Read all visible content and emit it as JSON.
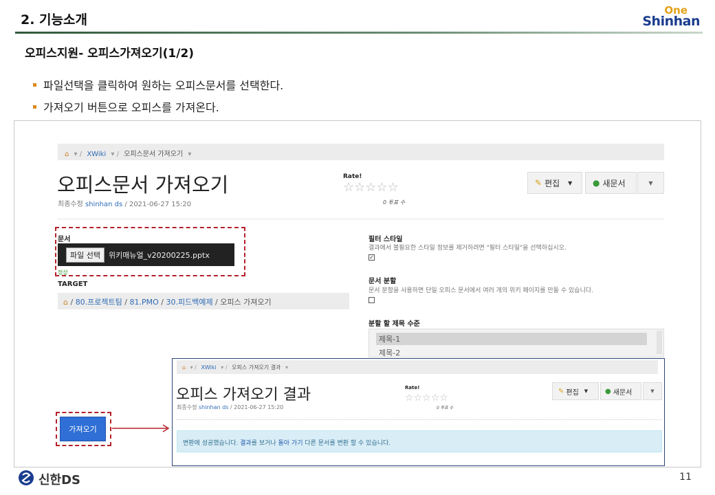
{
  "slide": {
    "title": "2. 기능소개",
    "logo_one": "One",
    "logo_shinhan": "Shinhan",
    "section_title": "오피스지원- 오피스가져오기(1/2)",
    "bullets": [
      "파일선택을 클릭하여 원하는 오피스문서를 선택한다.",
      "가져오기 버튼으로 오피스를 가져온다."
    ],
    "footer_logo": "신한DS",
    "page_number": "11"
  },
  "colors": {
    "accent_orange": "#d98b1a",
    "dashed_red": "#b3202a",
    "link_blue": "#2f6bb5",
    "primary_button": "#2f6fd6",
    "success_bg": "#d9edf7"
  },
  "wiki": {
    "breadcrumb": {
      "home_icon": "home-icon",
      "root": "XWiki",
      "page": "오피스문서 가져오기"
    },
    "page_title": "오피스문서 가져오기",
    "meta_prefix": "최종수정",
    "meta_user": "shinhan ds",
    "meta_date": "/ 2021-06-27 15:20",
    "rating_label": "Rate!",
    "rating_count": "0 투표 수",
    "edit_button": "편집",
    "new_doc_button": "새문서",
    "document_label": "문서",
    "file_select_button": "파일 선택",
    "file_name": "위키매뉴얼_v20200225.pptx",
    "status_text": "정상",
    "target_label": "TARGET",
    "target_path": [
      "80.프로젝트팀",
      "81.PMO",
      "30.피드백예제",
      "오피스 가져오기"
    ],
    "filter_style_label": "필터 스타일",
    "filter_style_hint": "결과에서 불필요한 스타일 정보를 제거하려면 \"필터 스타일\"을 선택하십시오.",
    "filter_style_checked": true,
    "split_doc_label": "문서 분할",
    "split_doc_hint": "문서 분할을 사용하면 단일 오피스 문서에서 여러 개의 위키 페이지를 만들 수 있습니다.",
    "split_doc_checked": false,
    "heading_level_label": "분할 할 제목 수준",
    "heading_options": [
      "제목-1",
      "제목-2"
    ],
    "import_button": "가져오기"
  },
  "result": {
    "breadcrumb": {
      "root": "XWiki",
      "page": "오피스 가져오기 결과"
    },
    "page_title": "오피스 가져오기 결과",
    "meta_prefix": "최종수정",
    "meta_user": "shinhan ds",
    "meta_date": "/ 2021-06-27 15:20",
    "rating_label": "Rate!",
    "rating_count": "0 투표 수",
    "edit_button": "편집",
    "new_doc_button": "새문서",
    "message_prefix": "변환에 성공했습니다. ",
    "message_link1": "결과",
    "message_mid": "를 보거나 ",
    "message_link2": "돌아 가기",
    "message_suffix": " 다른 문서를 변환 할 수 있습니다."
  }
}
